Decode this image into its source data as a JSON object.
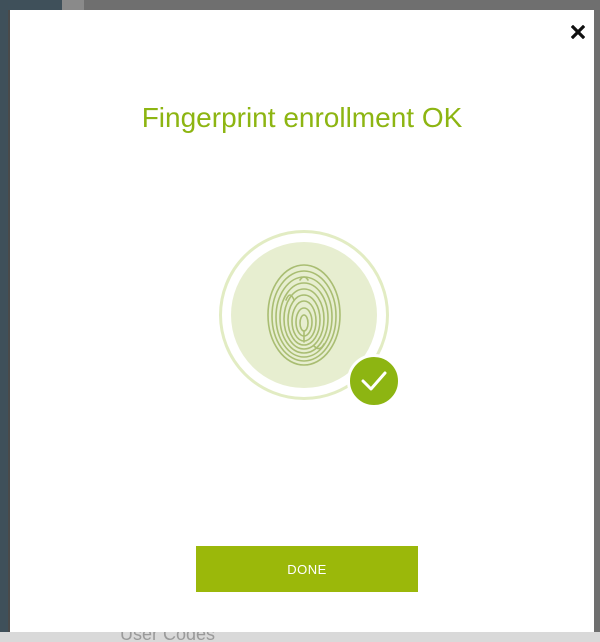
{
  "background": {
    "partial_text": "User Codes"
  },
  "dialog": {
    "title": "Fingerprint enrollment OK",
    "close_icon": "close-icon",
    "fingerprint_icon": "fingerprint-icon",
    "status_icon": "checkmark-icon",
    "done_label": "DONE"
  },
  "colors": {
    "accent": "#8db512",
    "button": "#9bb80a",
    "disc": "#e7eed0",
    "ring": "#e2ecc3"
  }
}
